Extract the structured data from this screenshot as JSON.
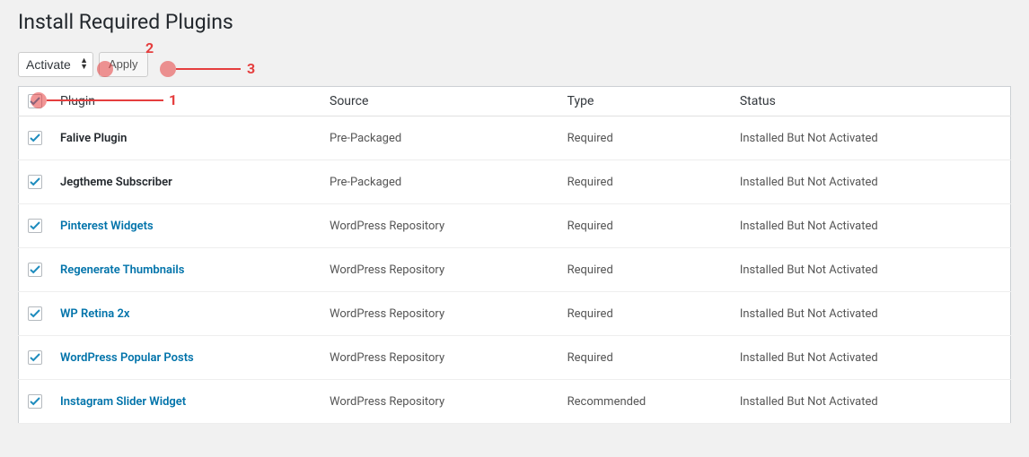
{
  "page_title": "Install Required Plugins",
  "bulk_action": {
    "selected": "Activate",
    "apply_label": "Apply"
  },
  "columns": {
    "plugin": "Plugin",
    "source": "Source",
    "type": "Type",
    "status": "Status"
  },
  "rows": [
    {
      "checked": true,
      "name": "Falive Plugin",
      "is_link": false,
      "source": "Pre-Packaged",
      "type": "Required",
      "status": "Installed But Not Activated"
    },
    {
      "checked": true,
      "name": "Jegtheme Subscriber",
      "is_link": false,
      "source": "Pre-Packaged",
      "type": "Required",
      "status": "Installed But Not Activated"
    },
    {
      "checked": true,
      "name": "Pinterest Widgets",
      "is_link": true,
      "source": "WordPress Repository",
      "type": "Required",
      "status": "Installed But Not Activated"
    },
    {
      "checked": true,
      "name": "Regenerate Thumbnails",
      "is_link": true,
      "source": "WordPress Repository",
      "type": "Required",
      "status": "Installed But Not Activated"
    },
    {
      "checked": true,
      "name": "WP Retina 2x",
      "is_link": true,
      "source": "WordPress Repository",
      "type": "Required",
      "status": "Installed But Not Activated"
    },
    {
      "checked": true,
      "name": "WordPress Popular Posts",
      "is_link": true,
      "source": "WordPress Repository",
      "type": "Required",
      "status": "Installed But Not Activated"
    },
    {
      "checked": true,
      "name": "Instagram Slider Widget",
      "is_link": true,
      "source": "WordPress Repository",
      "type": "Recommended",
      "status": "Installed But Not Activated"
    }
  ],
  "annotations": {
    "num1": "1",
    "num2": "2",
    "num3": "3"
  },
  "select_all_checked": true
}
